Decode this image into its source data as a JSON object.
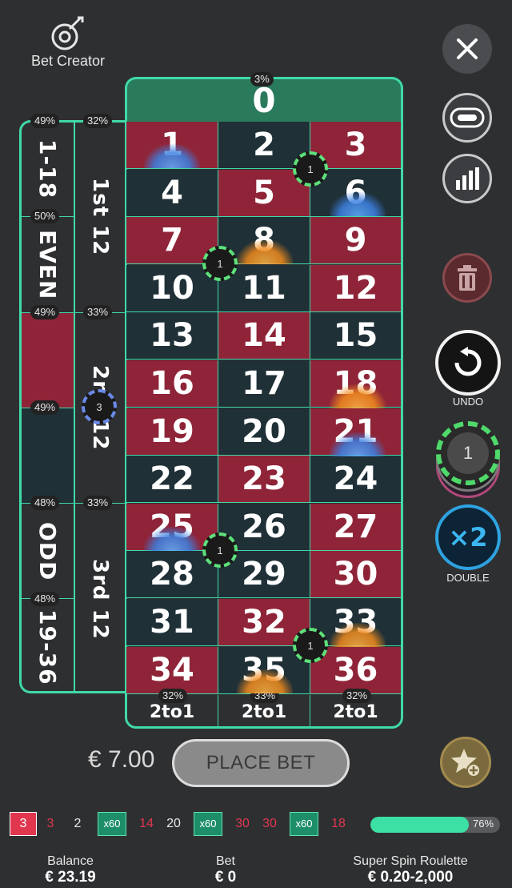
{
  "bet_creator": {
    "label": "Bet Creator"
  },
  "right_controls": {
    "undo_label": "UNDO",
    "chip_value": "1",
    "double_symbol": "×2",
    "double_label": "DOUBLE"
  },
  "table": {
    "zero": {
      "label": "0",
      "pct": "3%"
    },
    "numbers": [
      {
        "n": "1",
        "color": "red"
      },
      {
        "n": "2",
        "color": "black"
      },
      {
        "n": "3",
        "color": "red"
      },
      {
        "n": "4",
        "color": "black"
      },
      {
        "n": "5",
        "color": "red"
      },
      {
        "n": "6",
        "color": "black"
      },
      {
        "n": "7",
        "color": "red"
      },
      {
        "n": "8",
        "color": "black"
      },
      {
        "n": "9",
        "color": "red"
      },
      {
        "n": "10",
        "color": "black"
      },
      {
        "n": "11",
        "color": "black"
      },
      {
        "n": "12",
        "color": "red"
      },
      {
        "n": "13",
        "color": "black"
      },
      {
        "n": "14",
        "color": "red"
      },
      {
        "n": "15",
        "color": "black"
      },
      {
        "n": "16",
        "color": "red"
      },
      {
        "n": "17",
        "color": "black"
      },
      {
        "n": "18",
        "color": "red"
      },
      {
        "n": "19",
        "color": "red"
      },
      {
        "n": "20",
        "color": "black"
      },
      {
        "n": "21",
        "color": "red"
      },
      {
        "n": "22",
        "color": "black"
      },
      {
        "n": "23",
        "color": "red"
      },
      {
        "n": "24",
        "color": "black"
      },
      {
        "n": "25",
        "color": "red"
      },
      {
        "n": "26",
        "color": "black"
      },
      {
        "n": "27",
        "color": "red"
      },
      {
        "n": "28",
        "color": "black"
      },
      {
        "n": "29",
        "color": "black"
      },
      {
        "n": "30",
        "color": "red"
      },
      {
        "n": "31",
        "color": "black"
      },
      {
        "n": "32",
        "color": "red"
      },
      {
        "n": "33",
        "color": "black"
      },
      {
        "n": "34",
        "color": "red"
      },
      {
        "n": "35",
        "color": "black"
      },
      {
        "n": "36",
        "color": "red"
      }
    ],
    "outside_even": [
      {
        "label": "1-18",
        "pct": "49%"
      },
      {
        "label": "EVEN",
        "pct": "50%"
      },
      {
        "label": "",
        "pct": "49%"
      },
      {
        "label": "",
        "pct": "49%"
      },
      {
        "label": "ODD",
        "pct": "48%"
      },
      {
        "label": "19-36",
        "pct": "48%"
      }
    ],
    "dozens": [
      {
        "label": "1st 12",
        "pct": "32%"
      },
      {
        "label": "2nd 12",
        "pct": "33%"
      },
      {
        "label": "3rd 12",
        "pct": "33%"
      }
    ],
    "columns": [
      {
        "label": "2to1",
        "pct": "32%"
      },
      {
        "label": "2to1",
        "pct": "33%"
      },
      {
        "label": "2to1",
        "pct": "32%"
      }
    ],
    "chips": [
      "1",
      "1",
      "3",
      "1",
      "1"
    ]
  },
  "bet_panel": {
    "total": "€ 7.00",
    "place_bet_label": "PLACE BET"
  },
  "history": [
    {
      "v": "3",
      "style": "badge-red"
    },
    {
      "v": "3",
      "style": "red"
    },
    {
      "v": "2",
      "style": "white"
    },
    {
      "v": "x60",
      "style": "mult"
    },
    {
      "v": "14",
      "style": "red"
    },
    {
      "v": "20",
      "style": "white"
    },
    {
      "v": "x60",
      "style": "mult"
    },
    {
      "v": "30",
      "style": "red"
    },
    {
      "v": "30",
      "style": "red"
    },
    {
      "v": "x60",
      "style": "mult"
    },
    {
      "v": "18",
      "style": "red"
    }
  ],
  "progress": {
    "value": 0.76,
    "text": "76%"
  },
  "footer": {
    "balance_label": "Balance",
    "balance_value": "€ 23.19",
    "bet_label": "Bet",
    "bet_value": "€ 0",
    "game_label": "Super Spin Roulette",
    "game_limits": "€ 0.20-2,000"
  },
  "colors": {
    "accent": "#40d9a8",
    "red": "#8f2438",
    "black": "#1f3037"
  }
}
